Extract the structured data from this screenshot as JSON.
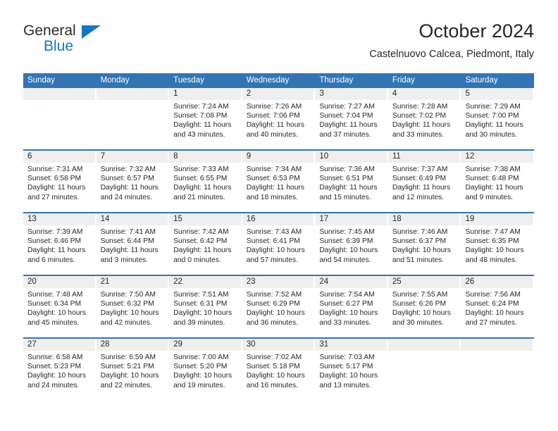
{
  "brand": {
    "name_part1": "General",
    "name_part2": "Blue",
    "accent_color": "#1278be"
  },
  "header": {
    "title": "October 2024",
    "subtitle": "Castelnuovo Calcea, Piedmont, Italy"
  },
  "theme": {
    "header_blue": "#3175b5",
    "cell_gray": "#efefef",
    "text": "#262626"
  },
  "weekdays": [
    "Sunday",
    "Monday",
    "Tuesday",
    "Wednesday",
    "Thursday",
    "Friday",
    "Saturday"
  ],
  "weeks": [
    [
      {
        "date": "",
        "sunrise": "",
        "sunset": "",
        "daylight1": "",
        "daylight2": ""
      },
      {
        "date": "",
        "sunrise": "",
        "sunset": "",
        "daylight1": "",
        "daylight2": ""
      },
      {
        "date": "1",
        "sunrise": "Sunrise: 7:24 AM",
        "sunset": "Sunset: 7:08 PM",
        "daylight1": "Daylight: 11 hours",
        "daylight2": "and 43 minutes."
      },
      {
        "date": "2",
        "sunrise": "Sunrise: 7:26 AM",
        "sunset": "Sunset: 7:06 PM",
        "daylight1": "Daylight: 11 hours",
        "daylight2": "and 40 minutes."
      },
      {
        "date": "3",
        "sunrise": "Sunrise: 7:27 AM",
        "sunset": "Sunset: 7:04 PM",
        "daylight1": "Daylight: 11 hours",
        "daylight2": "and 37 minutes."
      },
      {
        "date": "4",
        "sunrise": "Sunrise: 7:28 AM",
        "sunset": "Sunset: 7:02 PM",
        "daylight1": "Daylight: 11 hours",
        "daylight2": "and 33 minutes."
      },
      {
        "date": "5",
        "sunrise": "Sunrise: 7:29 AM",
        "sunset": "Sunset: 7:00 PM",
        "daylight1": "Daylight: 11 hours",
        "daylight2": "and 30 minutes."
      }
    ],
    [
      {
        "date": "6",
        "sunrise": "Sunrise: 7:31 AM",
        "sunset": "Sunset: 6:58 PM",
        "daylight1": "Daylight: 11 hours",
        "daylight2": "and 27 minutes."
      },
      {
        "date": "7",
        "sunrise": "Sunrise: 7:32 AM",
        "sunset": "Sunset: 6:57 PM",
        "daylight1": "Daylight: 11 hours",
        "daylight2": "and 24 minutes."
      },
      {
        "date": "8",
        "sunrise": "Sunrise: 7:33 AM",
        "sunset": "Sunset: 6:55 PM",
        "daylight1": "Daylight: 11 hours",
        "daylight2": "and 21 minutes."
      },
      {
        "date": "9",
        "sunrise": "Sunrise: 7:34 AM",
        "sunset": "Sunset: 6:53 PM",
        "daylight1": "Daylight: 11 hours",
        "daylight2": "and 18 minutes."
      },
      {
        "date": "10",
        "sunrise": "Sunrise: 7:36 AM",
        "sunset": "Sunset: 6:51 PM",
        "daylight1": "Daylight: 11 hours",
        "daylight2": "and 15 minutes."
      },
      {
        "date": "11",
        "sunrise": "Sunrise: 7:37 AM",
        "sunset": "Sunset: 6:49 PM",
        "daylight1": "Daylight: 11 hours",
        "daylight2": "and 12 minutes."
      },
      {
        "date": "12",
        "sunrise": "Sunrise: 7:38 AM",
        "sunset": "Sunset: 6:48 PM",
        "daylight1": "Daylight: 11 hours",
        "daylight2": "and 9 minutes."
      }
    ],
    [
      {
        "date": "13",
        "sunrise": "Sunrise: 7:39 AM",
        "sunset": "Sunset: 6:46 PM",
        "daylight1": "Daylight: 11 hours",
        "daylight2": "and 6 minutes."
      },
      {
        "date": "14",
        "sunrise": "Sunrise: 7:41 AM",
        "sunset": "Sunset: 6:44 PM",
        "daylight1": "Daylight: 11 hours",
        "daylight2": "and 3 minutes."
      },
      {
        "date": "15",
        "sunrise": "Sunrise: 7:42 AM",
        "sunset": "Sunset: 6:42 PM",
        "daylight1": "Daylight: 11 hours",
        "daylight2": "and 0 minutes."
      },
      {
        "date": "16",
        "sunrise": "Sunrise: 7:43 AM",
        "sunset": "Sunset: 6:41 PM",
        "daylight1": "Daylight: 10 hours",
        "daylight2": "and 57 minutes."
      },
      {
        "date": "17",
        "sunrise": "Sunrise: 7:45 AM",
        "sunset": "Sunset: 6:39 PM",
        "daylight1": "Daylight: 10 hours",
        "daylight2": "and 54 minutes."
      },
      {
        "date": "18",
        "sunrise": "Sunrise: 7:46 AM",
        "sunset": "Sunset: 6:37 PM",
        "daylight1": "Daylight: 10 hours",
        "daylight2": "and 51 minutes."
      },
      {
        "date": "19",
        "sunrise": "Sunrise: 7:47 AM",
        "sunset": "Sunset: 6:35 PM",
        "daylight1": "Daylight: 10 hours",
        "daylight2": "and 48 minutes."
      }
    ],
    [
      {
        "date": "20",
        "sunrise": "Sunrise: 7:48 AM",
        "sunset": "Sunset: 6:34 PM",
        "daylight1": "Daylight: 10 hours",
        "daylight2": "and 45 minutes."
      },
      {
        "date": "21",
        "sunrise": "Sunrise: 7:50 AM",
        "sunset": "Sunset: 6:32 PM",
        "daylight1": "Daylight: 10 hours",
        "daylight2": "and 42 minutes."
      },
      {
        "date": "22",
        "sunrise": "Sunrise: 7:51 AM",
        "sunset": "Sunset: 6:31 PM",
        "daylight1": "Daylight: 10 hours",
        "daylight2": "and 39 minutes."
      },
      {
        "date": "23",
        "sunrise": "Sunrise: 7:52 AM",
        "sunset": "Sunset: 6:29 PM",
        "daylight1": "Daylight: 10 hours",
        "daylight2": "and 36 minutes."
      },
      {
        "date": "24",
        "sunrise": "Sunrise: 7:54 AM",
        "sunset": "Sunset: 6:27 PM",
        "daylight1": "Daylight: 10 hours",
        "daylight2": "and 33 minutes."
      },
      {
        "date": "25",
        "sunrise": "Sunrise: 7:55 AM",
        "sunset": "Sunset: 6:26 PM",
        "daylight1": "Daylight: 10 hours",
        "daylight2": "and 30 minutes."
      },
      {
        "date": "26",
        "sunrise": "Sunrise: 7:56 AM",
        "sunset": "Sunset: 6:24 PM",
        "daylight1": "Daylight: 10 hours",
        "daylight2": "and 27 minutes."
      }
    ],
    [
      {
        "date": "27",
        "sunrise": "Sunrise: 6:58 AM",
        "sunset": "Sunset: 5:23 PM",
        "daylight1": "Daylight: 10 hours",
        "daylight2": "and 24 minutes."
      },
      {
        "date": "28",
        "sunrise": "Sunrise: 6:59 AM",
        "sunset": "Sunset: 5:21 PM",
        "daylight1": "Daylight: 10 hours",
        "daylight2": "and 22 minutes."
      },
      {
        "date": "29",
        "sunrise": "Sunrise: 7:00 AM",
        "sunset": "Sunset: 5:20 PM",
        "daylight1": "Daylight: 10 hours",
        "daylight2": "and 19 minutes."
      },
      {
        "date": "30",
        "sunrise": "Sunrise: 7:02 AM",
        "sunset": "Sunset: 5:18 PM",
        "daylight1": "Daylight: 10 hours",
        "daylight2": "and 16 minutes."
      },
      {
        "date": "31",
        "sunrise": "Sunrise: 7:03 AM",
        "sunset": "Sunset: 5:17 PM",
        "daylight1": "Daylight: 10 hours",
        "daylight2": "and 13 minutes."
      },
      {
        "date": "",
        "sunrise": "",
        "sunset": "",
        "daylight1": "",
        "daylight2": ""
      },
      {
        "date": "",
        "sunrise": "",
        "sunset": "",
        "daylight1": "",
        "daylight2": ""
      }
    ]
  ]
}
